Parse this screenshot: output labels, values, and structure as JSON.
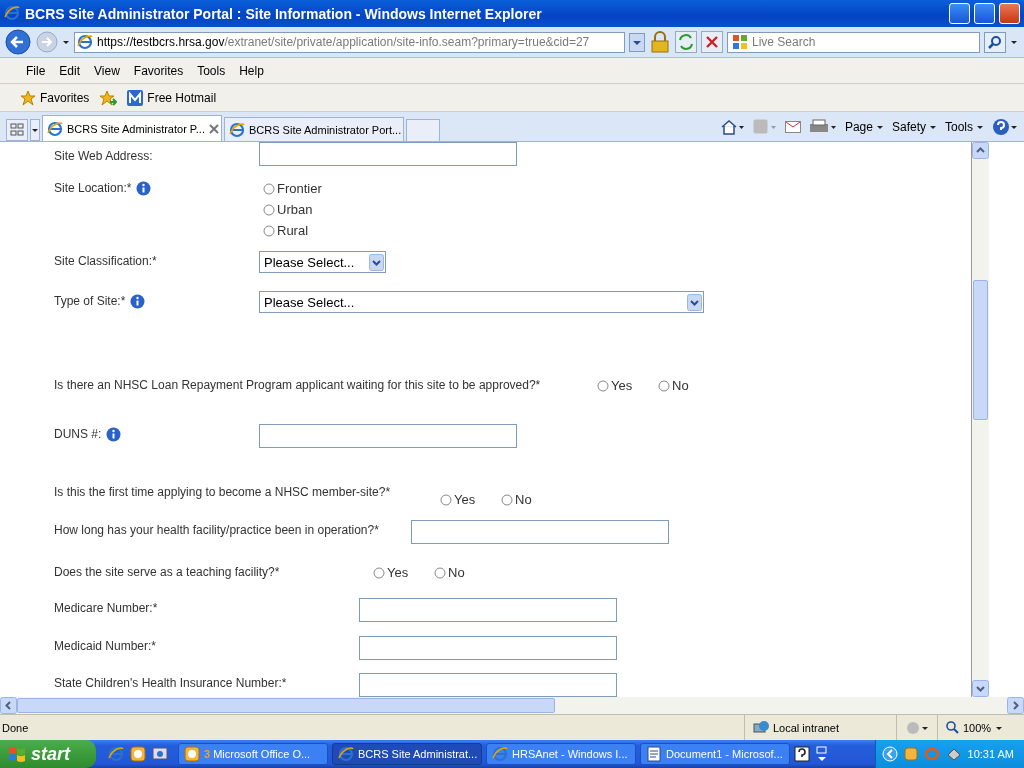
{
  "window": {
    "title": "BCRS Site Administrator Portal : Site Information - Windows Internet Explorer"
  },
  "address_bar": {
    "scheme": "https://testbcrs.",
    "domain": "hrsa.gov",
    "path": "/extranet/site/private/application/site-info.seam?primary=true&cid=27"
  },
  "search": {
    "placeholder": "Live Search"
  },
  "menu": [
    "File",
    "Edit",
    "View",
    "Favorites",
    "Tools",
    "Help"
  ],
  "favorites_bar": {
    "favorites": "Favorites",
    "links": [
      "Free Hotmail"
    ]
  },
  "tabs": [
    {
      "label": "BCRS Site Administrator P...",
      "selected": true
    },
    {
      "label": "BCRS Site Administrator Port...",
      "selected": false
    }
  ],
  "command_bar": [
    "Page",
    "Safety",
    "Tools"
  ],
  "form": {
    "rows": [
      {
        "kind": "text",
        "label": "Site Web Address:",
        "info": false
      },
      {
        "kind": "radio",
        "label": "Site Location:*",
        "info": true,
        "options": [
          {
            "label": "Frontier",
            "selected": false
          },
          {
            "label": "Urban",
            "selected": false
          },
          {
            "label": "Rural",
            "selected": false
          }
        ]
      },
      {
        "kind": "select",
        "label": "Site Classification:*",
        "info": false,
        "value": "Please Select..."
      },
      {
        "kind": "select",
        "label": "Type of Site:*",
        "info": true,
        "value": "Please Select..."
      },
      {
        "kind": "radio",
        "label": "Is there an NHSC Loan Repayment Program applicant waiting for this site to be approved?*",
        "info": false,
        "options": [
          {
            "label": "Yes",
            "selected": false
          },
          {
            "label": "No",
            "selected": false
          }
        ]
      },
      {
        "kind": "text",
        "label": "DUNS #:",
        "info": true
      },
      {
        "kind": "radio",
        "label": "Is this the first time applying to become a NHSC member-site?*",
        "info": false,
        "options": [
          {
            "label": "Yes",
            "selected": false
          },
          {
            "label": "No",
            "selected": false
          }
        ]
      },
      {
        "kind": "text",
        "label": "How long has your health facility/practice been in operation?*",
        "info": false
      },
      {
        "kind": "radio",
        "label": "Does the site serve as a teaching facility?*",
        "info": false,
        "options": [
          {
            "label": "Yes",
            "selected": false
          },
          {
            "label": "No",
            "selected": false
          }
        ]
      },
      {
        "kind": "text",
        "label": "Medicare Number:*",
        "info": false
      },
      {
        "kind": "text",
        "label": "Medicaid Number:*",
        "info": false
      },
      {
        "kind": "text",
        "label": "State Children's Health Insurance Number:*",
        "info": false
      }
    ]
  },
  "status_bar": {
    "text": "Done",
    "zone": "Local intranet",
    "zoom": "100%"
  },
  "taskbar": {
    "start": "start",
    "buttons": [
      {
        "label": "**3** Microsoft Office O...",
        "selected": false
      },
      {
        "label": "BCRS Site Administrat...",
        "selected": true
      },
      {
        "label": "HRSAnet - Windows I...",
        "selected": false
      },
      {
        "label": "Document1 - Microsof...",
        "selected": false
      }
    ],
    "clock": "10:31 AM"
  }
}
